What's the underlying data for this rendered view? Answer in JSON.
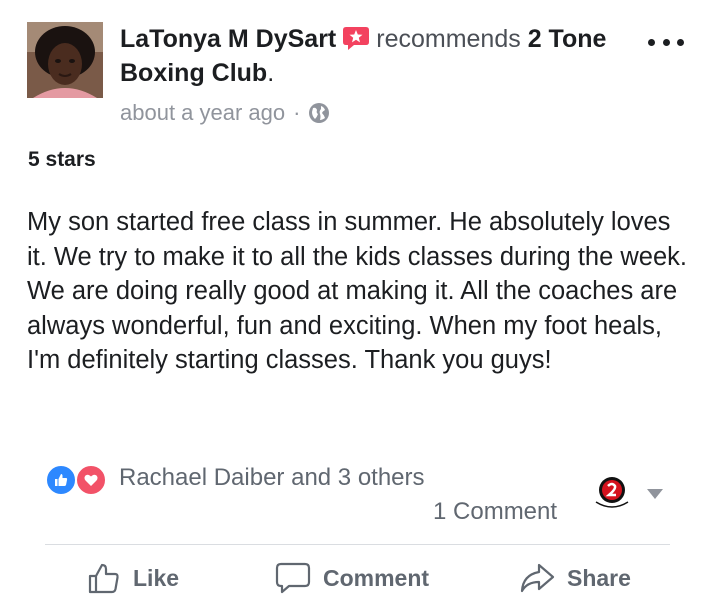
{
  "post": {
    "author": "LaTonya M DySart",
    "recommends_text": "recommends",
    "page_name": "2 Tone Boxing Club",
    "page_name_suffix": ".",
    "timestamp": "about a year ago",
    "separator": "·",
    "audience_icon": "globe-icon",
    "rating_text": "5 stars",
    "review_text": "My son started free class in summer. He absolutely loves it. We try to make it to all the kids classes during the week. We are doing really good at making it. All the coaches are always wonderful, fun and exciting. When my foot heals, I'm definitely starting classes. Thank you guys!"
  },
  "reactions": {
    "icons": [
      "like-reaction-icon",
      "love-reaction-icon"
    ],
    "summary": "Rachael Daiber and 3 others",
    "comments": "1 Comment"
  },
  "actions": {
    "like": "Like",
    "comment": "Comment",
    "share": "Share"
  },
  "colors": {
    "recommend_badge": "#f3425f",
    "like_blue": "#2d88ff",
    "love_red": "#f25268",
    "muted_text": "#90949c",
    "action_text": "#606770"
  }
}
